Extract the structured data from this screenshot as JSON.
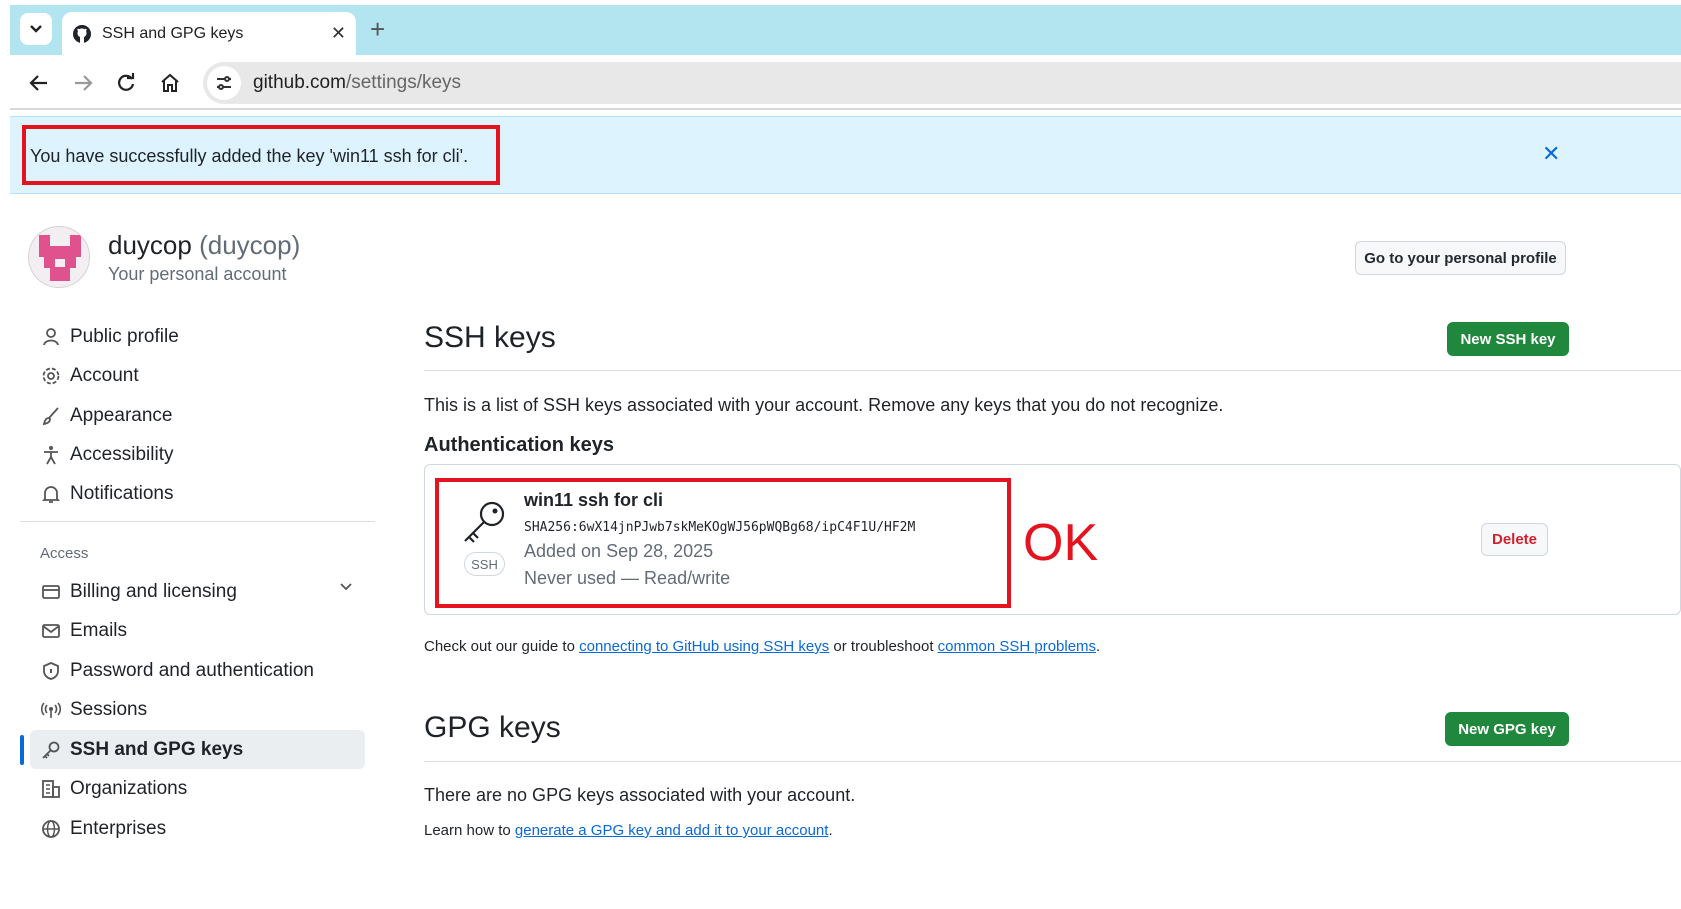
{
  "browser": {
    "tab_title": "SSH and GPG keys",
    "tab_close": "✕",
    "new_tab": "+",
    "url_host": "github.com",
    "url_path": "/settings/keys"
  },
  "flash": {
    "message": "You have successfully added the key 'win11 ssh for cli'.",
    "close": "✕"
  },
  "header": {
    "name": "duycop",
    "login": "(duycop)",
    "subtitle": "Your personal account",
    "profile_button": "Go to your personal profile"
  },
  "sidebar": {
    "items": [
      {
        "label": "Public profile",
        "icon": "person-icon"
      },
      {
        "label": "Account",
        "icon": "gear-icon"
      },
      {
        "label": "Appearance",
        "icon": "paintbrush-icon"
      },
      {
        "label": "Accessibility",
        "icon": "accessibility-icon"
      },
      {
        "label": "Notifications",
        "icon": "bell-icon"
      }
    ],
    "access_heading": "Access",
    "access_items": [
      {
        "label": "Billing and licensing",
        "icon": "credit-card-icon"
      },
      {
        "label": "Emails",
        "icon": "mail-icon"
      },
      {
        "label": "Password and authentication",
        "icon": "shield-lock-icon"
      },
      {
        "label": "Sessions",
        "icon": "broadcast-icon"
      },
      {
        "label": "SSH and GPG keys",
        "icon": "key-icon"
      },
      {
        "label": "Organizations",
        "icon": "organization-icon"
      },
      {
        "label": "Enterprises",
        "icon": "globe-icon"
      }
    ]
  },
  "ssh": {
    "title": "SSH keys",
    "new_button": "New SSH key",
    "description": "This is a list of SSH keys associated with your account. Remove any keys that you do not recognize.",
    "auth_heading": "Authentication keys",
    "key": {
      "badge": "SSH",
      "title": "win11 ssh for cli",
      "fingerprint": "SHA256:6wX14jnPJwb7skMeKOgWJ56pWQBg68/ipC4F1U/HF2M",
      "added": "Added on Sep 28, 2025",
      "usage": "Never used — Read/write",
      "delete_button": "Delete"
    },
    "annotation": "OK",
    "guide_prefix": "Check out our guide to ",
    "guide_link1": "connecting to GitHub using SSH keys",
    "guide_middle": " or troubleshoot ",
    "guide_link2": "common SSH problems",
    "guide_suffix": "."
  },
  "gpg": {
    "title": "GPG keys",
    "new_button": "New GPG key",
    "empty": "There are no GPG keys associated with your account.",
    "learn_prefix": "Learn how to ",
    "learn_link": "generate a GPG key and add it to your account",
    "learn_suffix": "."
  },
  "colors": {
    "accent": "#0969da",
    "green": "#1f883d",
    "annotation_red": "#e3141f",
    "banner_bg": "#ddf4ff",
    "tabbar_bg": "#b3e5f0"
  }
}
